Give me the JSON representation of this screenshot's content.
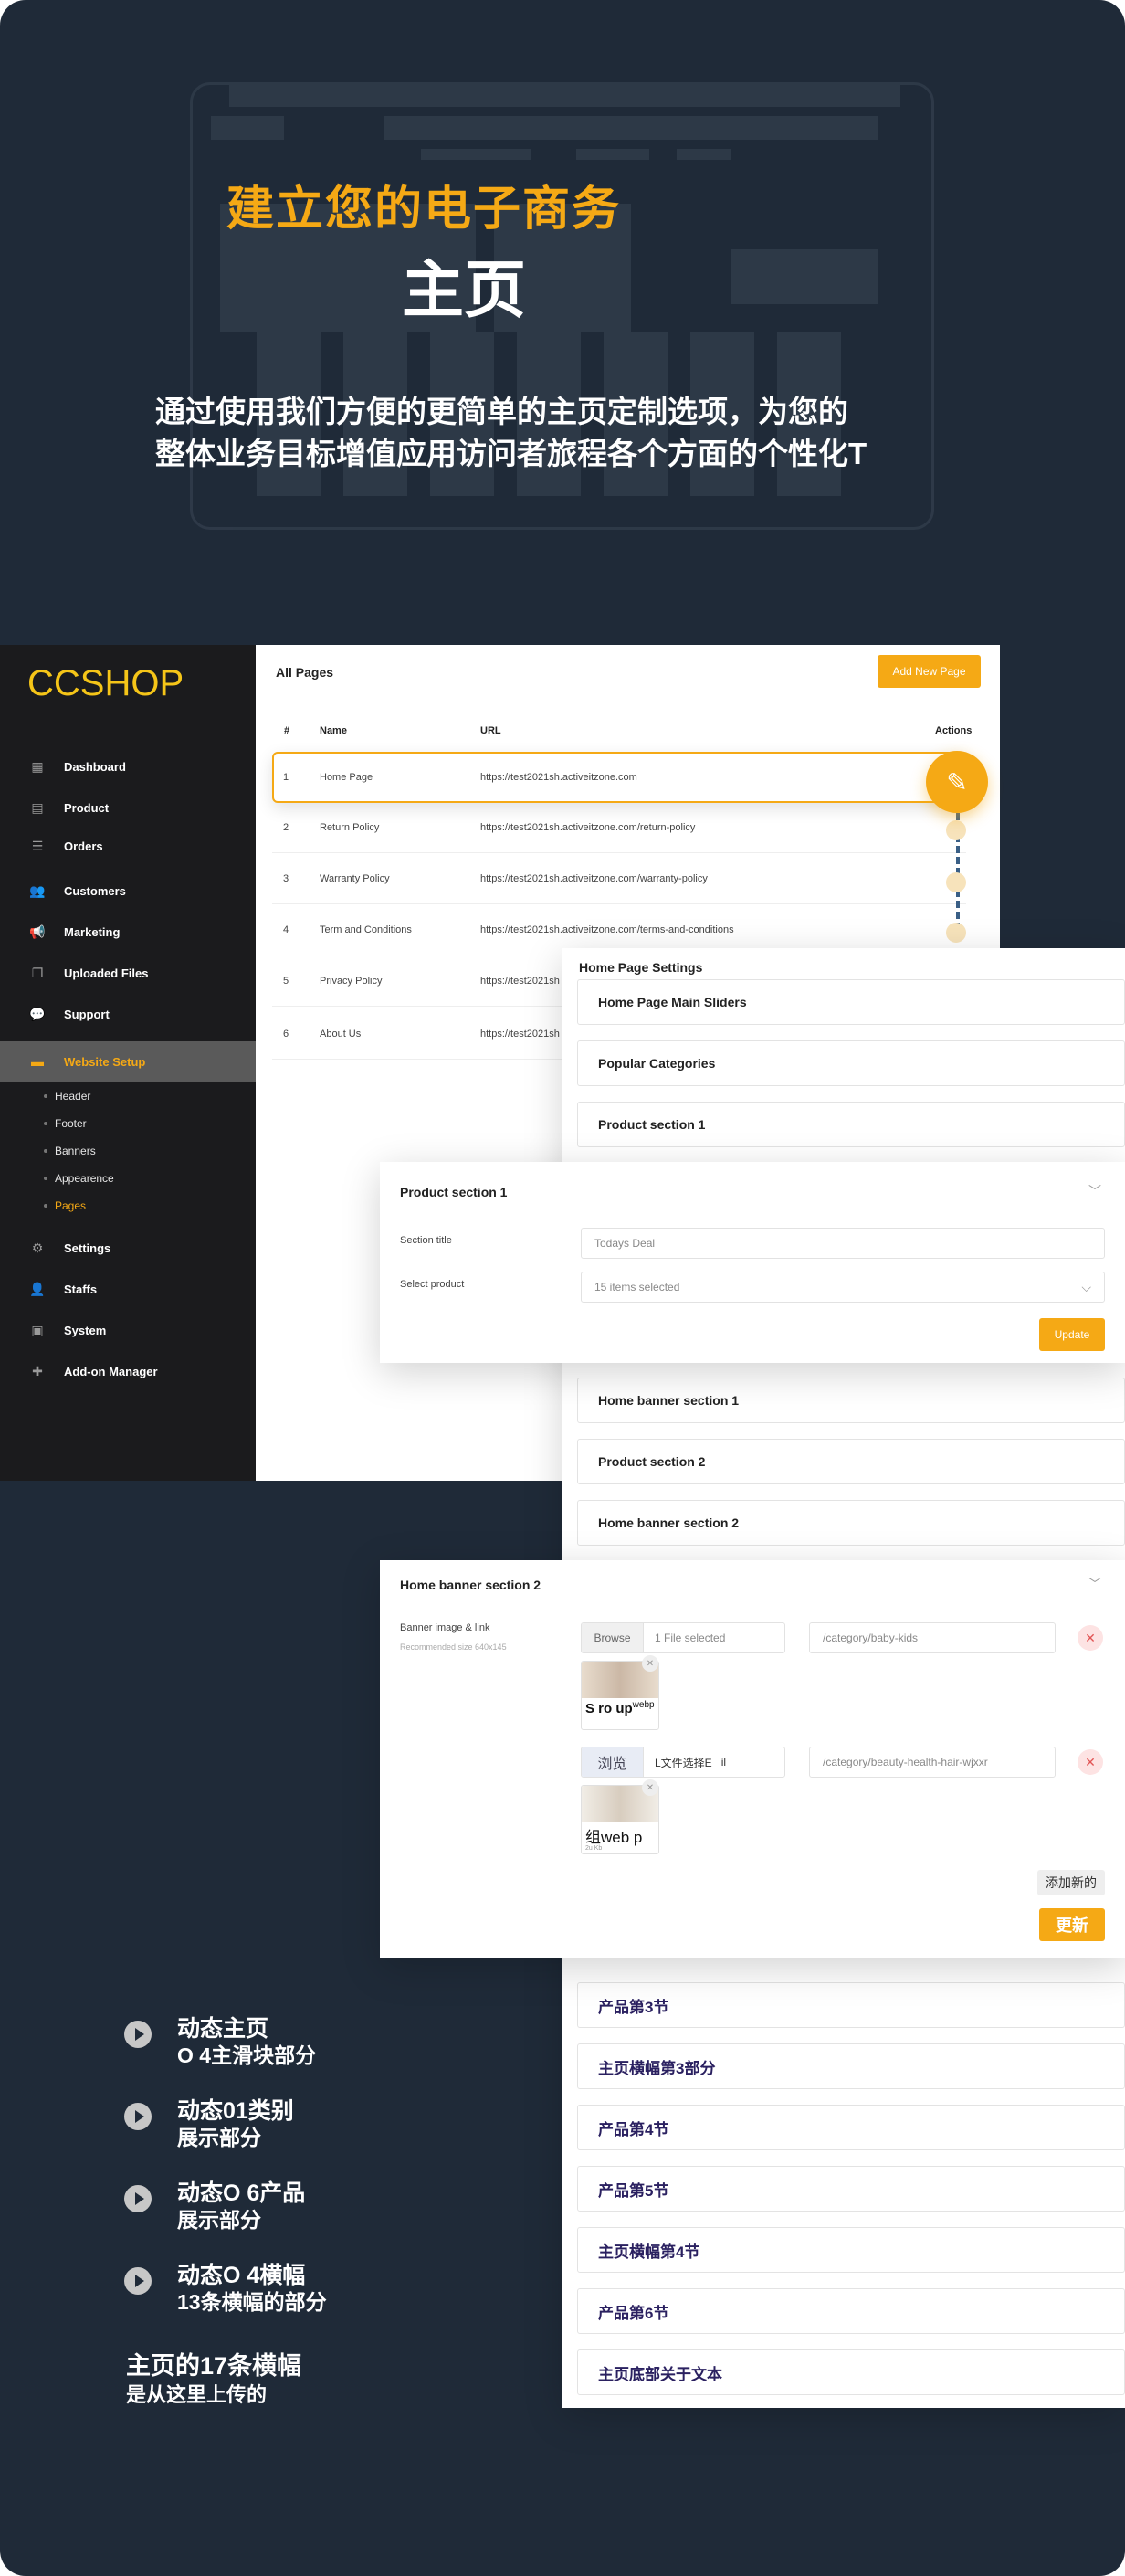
{
  "hero": {
    "title_line1": "建立您的电子商务",
    "title_line2": "主页",
    "desc_line1": "通过使用我们方便的更简单的主页定制选项，为您的",
    "desc_line2": "整体业务目标增值应用访问者旅程各个方面的个性化T"
  },
  "sidebar": {
    "logo": "CCSHOP",
    "items": [
      {
        "label": "Dashboard",
        "icon": "dashboard-icon"
      },
      {
        "label": "Product",
        "icon": "product-icon"
      },
      {
        "label": "Orders",
        "icon": "orders-icon"
      },
      {
        "label": "Customers",
        "icon": "customers-icon"
      },
      {
        "label": "Marketing",
        "icon": "megaphone-icon"
      },
      {
        "label": "Uploaded Files",
        "icon": "files-icon"
      },
      {
        "label": "Support",
        "icon": "support-icon"
      },
      {
        "label": "Website Setup",
        "icon": "monitor-icon"
      },
      {
        "label": "Settings",
        "icon": "gear-icon"
      },
      {
        "label": "Staffs",
        "icon": "user-icon"
      },
      {
        "label": "System",
        "icon": "system-icon"
      },
      {
        "label": "Add-on Manager",
        "icon": "puzzle-icon"
      }
    ],
    "subitems": [
      "Header",
      "Footer",
      "Banners",
      "Appearence",
      "Pages"
    ]
  },
  "pages": {
    "title": "All Pages",
    "add_button": "Add New Page",
    "columns": [
      "#",
      "Name",
      "URL",
      "Actions"
    ],
    "rows": [
      {
        "num": "1",
        "name": "Home Page",
        "url": "https://test2021sh.activeitzone.com"
      },
      {
        "num": "2",
        "name": "Return Policy",
        "url": "https://test2021sh.activeitzone.com/return-policy"
      },
      {
        "num": "3",
        "name": "Warranty Policy",
        "url": "https://test2021sh.activeitzone.com/warranty-policy"
      },
      {
        "num": "4",
        "name": "Term and Conditions",
        "url": "https://test2021sh.activeitzone.com/terms-and-conditions"
      },
      {
        "num": "5",
        "name": "Privacy Policy",
        "url": "https://test2021sh"
      },
      {
        "num": "6",
        "name": "About Us",
        "url": "https://test2021sh"
      }
    ]
  },
  "home_settings": {
    "title": "Home Page Settings",
    "sections": [
      "Home Page Main Sliders",
      "Popular Categories",
      "Product section 1",
      "Home banner section 1",
      "Product section 2",
      "Home banner section 2"
    ],
    "sections_cn": [
      "产品第3节",
      "主页横幅第3部分",
      "产品第4节",
      "产品第5节",
      "主页横幅第4节",
      "产品第6节",
      "主页底部关于文本"
    ]
  },
  "product_section": {
    "title": "Product section 1",
    "section_title_label": "Section title",
    "section_title_placeholder": "Todays Deal",
    "select_product_label": "Select product",
    "select_value": "15 items selected",
    "update": "Update"
  },
  "banner_section": {
    "title": "Home banner section 2",
    "label": "Banner image & link",
    "hint": "Recommended size 640x145",
    "browse1": "Browse",
    "file1": "1 File selected",
    "link1": "/category/baby-kids",
    "thumb1_text": "S ro up",
    "thumb1_ext": "webp",
    "browse2": "浏览",
    "file2": "L文件选择E",
    "file2_extra": "il",
    "link2": "/category/beauty-health-hair-wjxxr",
    "thumb2_text": "组web p",
    "thumb2_small": "2u Kb",
    "add_new": "添加新的",
    "update": "更新"
  },
  "features": [
    {
      "t1": "动态主页",
      "t2": "O 4主滑块部分"
    },
    {
      "t1": "动态01类别",
      "t2": "展示部分"
    },
    {
      "t1": "动态O 6产品",
      "t2": "展示部分"
    },
    {
      "t1": "动态O 4横幅",
      "t2": "13条横幅的部分"
    }
  ],
  "final": {
    "line1": "主页的17条横幅",
    "line2": "是从这里上传的"
  },
  "colors": {
    "accent": "#f5a915",
    "dark_bg": "#1f2a38",
    "sidebar_bg": "#1b1b1d"
  }
}
